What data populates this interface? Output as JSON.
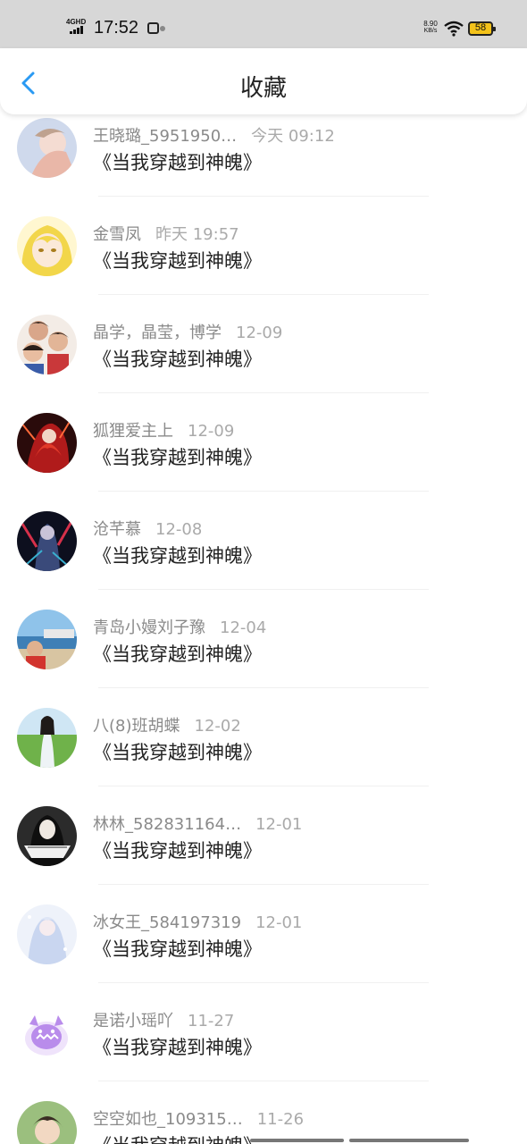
{
  "status_bar": {
    "network": "4GHD",
    "time": "17:52",
    "speed_value": "8.90",
    "speed_unit": "KB/s",
    "battery": "58"
  },
  "header": {
    "title": "收藏",
    "back_icon": "chevron-left-icon"
  },
  "accent_color": "#2a9af3",
  "favorites": [
    {
      "user": "王晓璐_5951950…",
      "time": "今天 09:12",
      "title": "《当我穿越到神魄》"
    },
    {
      "user": "金雪凤",
      "time": "昨天 19:57",
      "title": "《当我穿越到神魄》"
    },
    {
      "user": "晶学，晶莹，博学",
      "time": "12-09",
      "title": "《当我穿越到神魄》"
    },
    {
      "user": "狐狸爱主上",
      "time": "12-09",
      "title": "《当我穿越到神魄》"
    },
    {
      "user": "沧芊慕",
      "time": "12-08",
      "title": "《当我穿越到神魄》"
    },
    {
      "user": "青岛小嫚刘子豫",
      "time": "12-04",
      "title": "《当我穿越到神魄》"
    },
    {
      "user": "八(8)班胡蝶",
      "time": "12-02",
      "title": "《当我穿越到神魄》"
    },
    {
      "user": "林林_582831164…",
      "time": "12-01",
      "title": "《当我穿越到神魄》"
    },
    {
      "user": "冰女王_584197319",
      "time": "12-01",
      "title": "《当我穿越到神魄》"
    },
    {
      "user": "是诺小瑶吖",
      "time": "11-27",
      "title": "《当我穿越到神魄》"
    },
    {
      "user": "空空如也_109315…",
      "time": "11-26",
      "title": "《当我穿越到神魄》"
    }
  ]
}
